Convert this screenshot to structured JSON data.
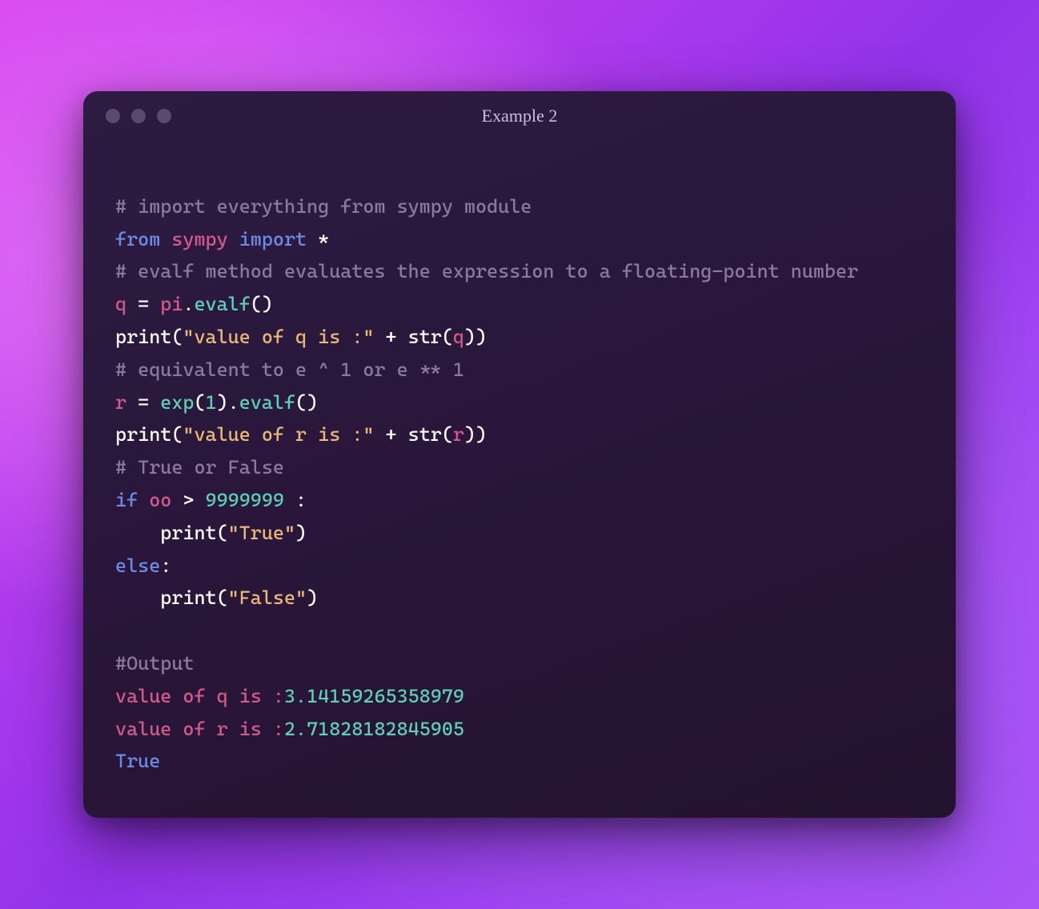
{
  "window": {
    "title": "Example 2"
  },
  "code": {
    "l1_comment": "# import everything from sympy module",
    "l2_from": "from",
    "l2_module": "sympy",
    "l2_import": "import",
    "l2_star": "*",
    "l3_comment": "# evalf method evaluates the expression to a floating-point number",
    "l4_var": "q",
    "l4_eq": " = ",
    "l4_pi": "pi",
    "l4_dot": ".",
    "l4_evalf": "evalf",
    "l4_paren": "()",
    "l5_print": "print",
    "l5_open": "(",
    "l5_str1": "\"value of q is :\"",
    "l5_plus": " + ",
    "l5_strf": "str",
    "l5_open2": "(",
    "l5_q": "q",
    "l5_close": "))",
    "l6_comment": "# equivalent to e ^ 1 or e ** 1",
    "l7_var": "r",
    "l7_eq": " = ",
    "l7_exp": "exp",
    "l7_open": "(",
    "l7_one": "1",
    "l7_close": ")",
    "l7_dot": ".",
    "l7_evalf": "evalf",
    "l7_paren": "()",
    "l8_print": "print",
    "l8_open": "(",
    "l8_str1": "\"value of r is :\"",
    "l8_plus": " + ",
    "l8_strf": "str",
    "l8_open2": "(",
    "l8_r": "r",
    "l8_close": "))",
    "l9_comment": "# True or False",
    "l10_if": "if",
    "l10_sp": " ",
    "l10_oo": "oo",
    "l10_gt": " > ",
    "l10_num": "9999999",
    "l10_colon": " :",
    "l11_indent": "    ",
    "l11_print": "print",
    "l11_open": "(",
    "l11_str": "\"True\"",
    "l11_close": ")",
    "l12_else": "else",
    "l12_colon": ":",
    "l13_indent": "    ",
    "l13_print": "print",
    "l13_open": "(",
    "l13_str": "\"False\"",
    "l13_close": ")",
    "blank": "",
    "out_header": "#Output",
    "out1_lbl": "value of q is :",
    "out1_val": "3.14159265358979",
    "out2_lbl": "value of r is :",
    "out2_val": "2.71828182845905",
    "out3": "True"
  }
}
